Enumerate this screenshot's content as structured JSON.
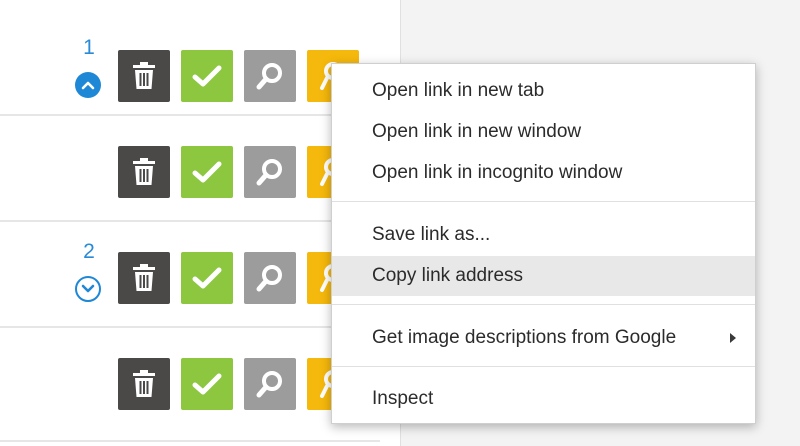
{
  "rows": [
    {
      "number": "1",
      "arrow": "arrow-up-circle-icon"
    },
    {
      "number": "",
      "arrow": ""
    },
    {
      "number": "2",
      "arrow": "arrow-down-circle-icon"
    },
    {
      "number": "",
      "arrow": ""
    }
  ],
  "actions": {
    "icons": [
      "trash-icon",
      "check-icon",
      "search-icon",
      "user-icon"
    ],
    "colors": {
      "trash": "#4b4848",
      "check": "#8dc63f",
      "search": "#9c9c9c",
      "extra": "#f5b80c"
    }
  },
  "context_menu": {
    "items": [
      "Open link in new tab",
      "Open link in new window",
      "Open link in incognito window",
      "Save link as...",
      "Copy link address",
      "Get image descriptions from Google",
      "Inspect"
    ],
    "highlighted": "Copy link address"
  },
  "accent_color": "#1f88d6"
}
